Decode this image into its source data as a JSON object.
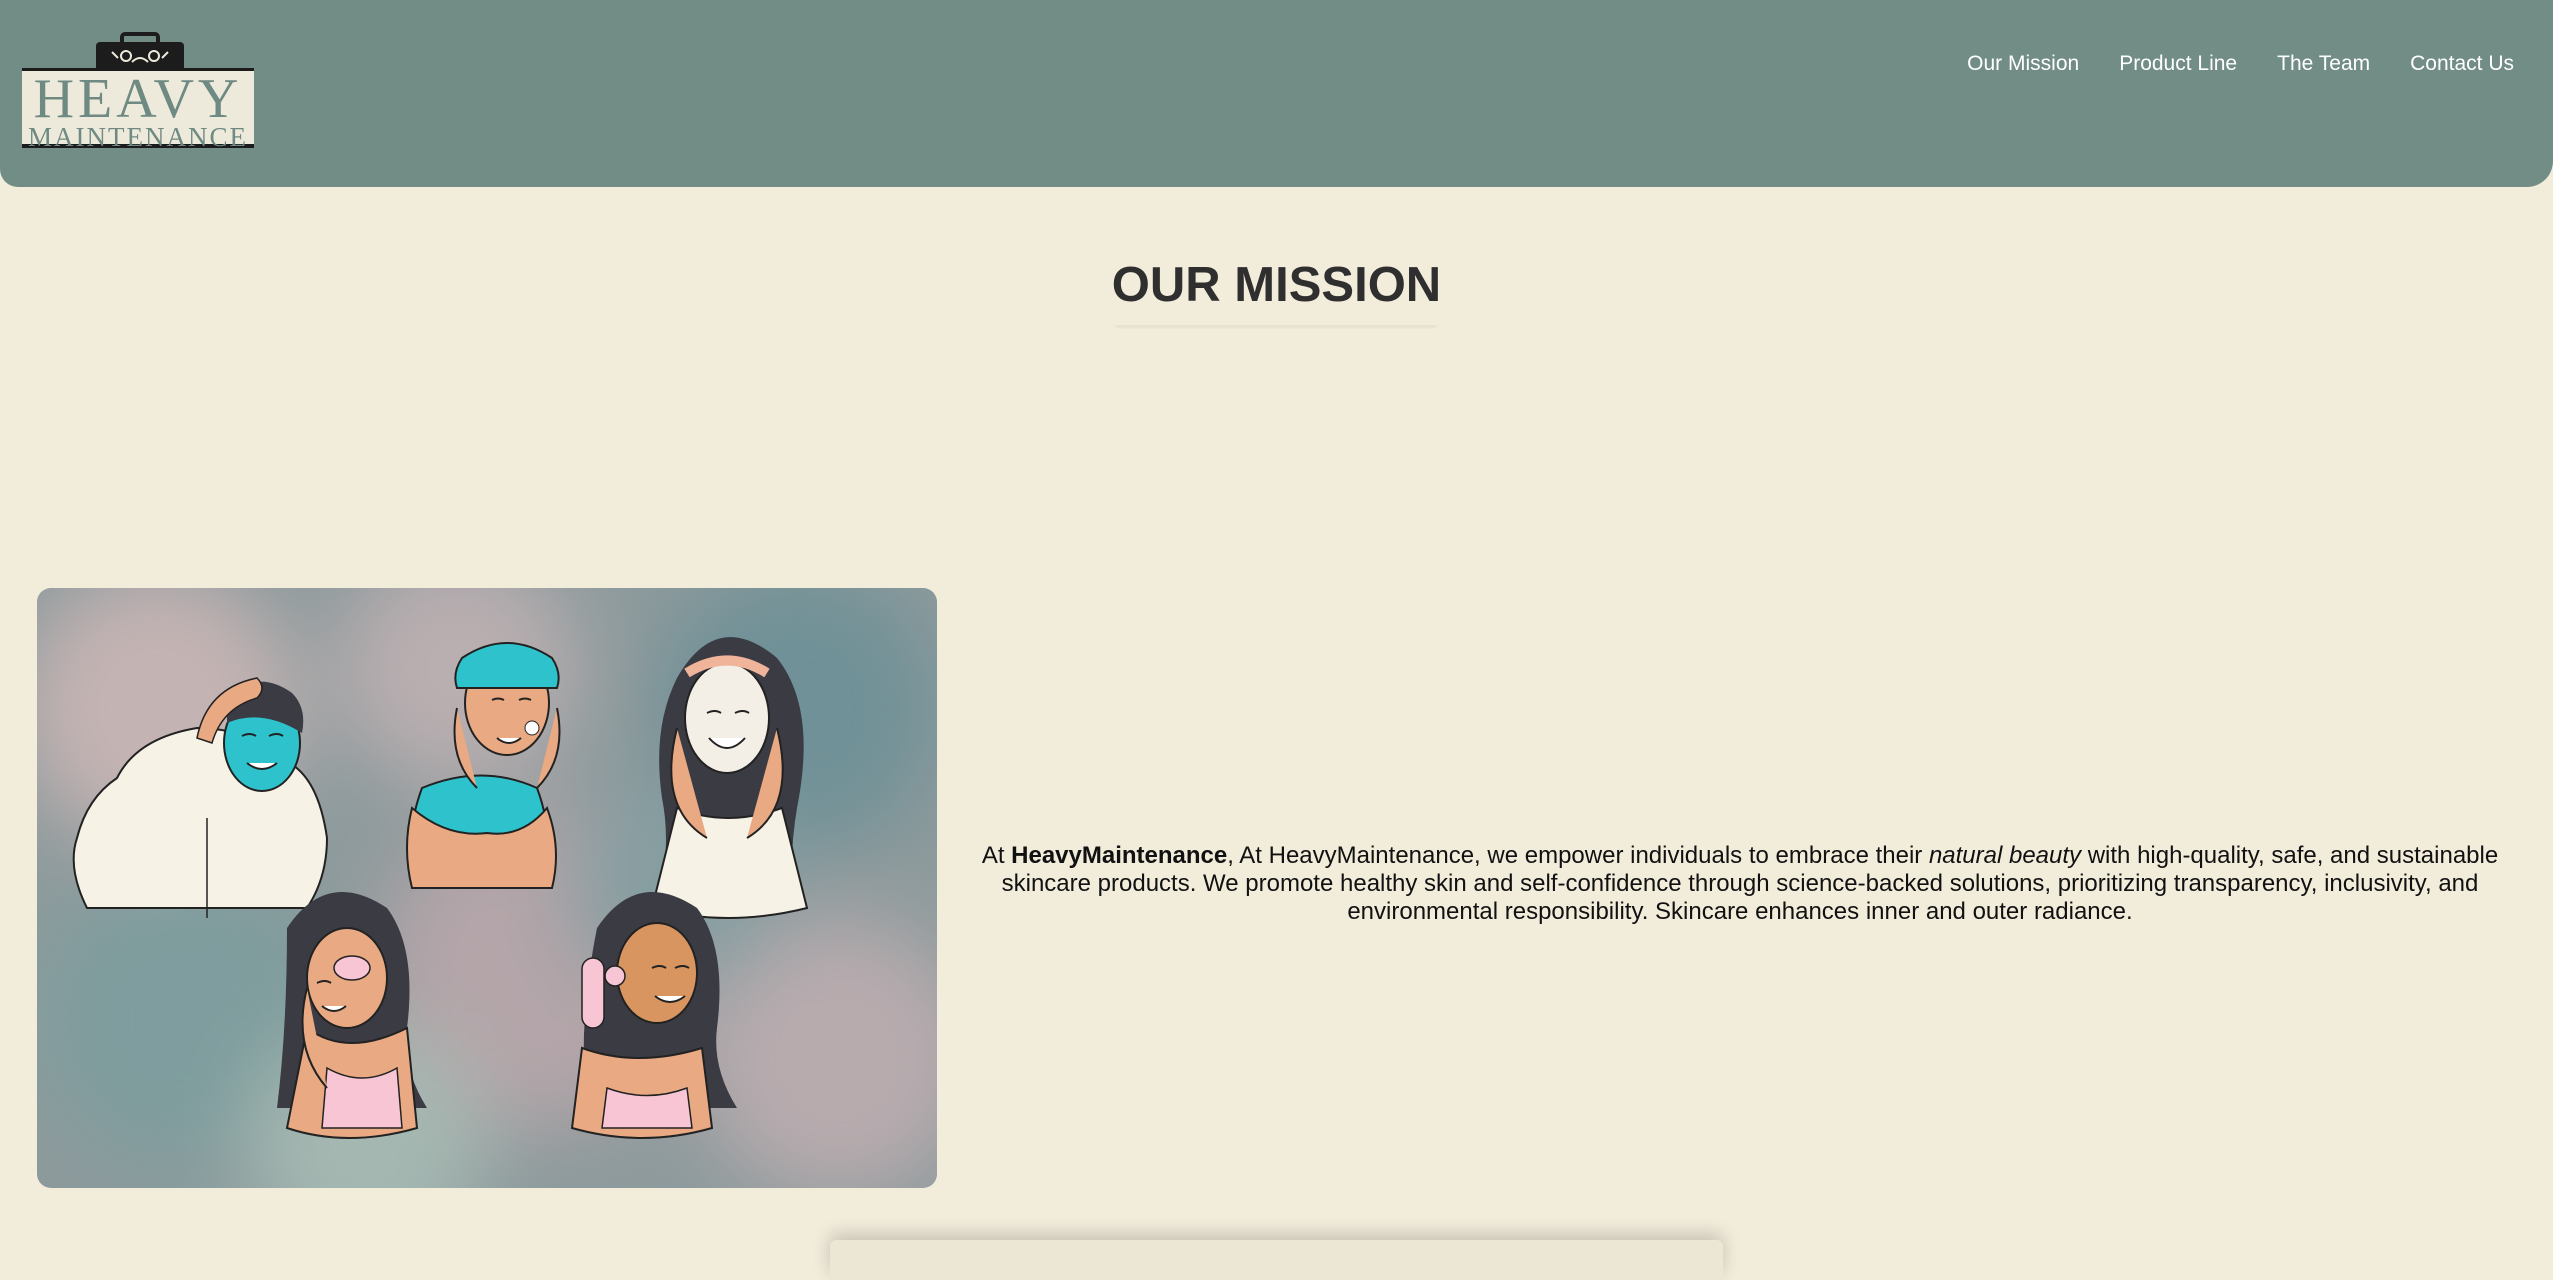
{
  "header": {
    "logo": {
      "line1": "HEAVY",
      "line2": "MAINTENANCE",
      "icon": "briefcase-icon"
    },
    "nav": [
      {
        "label": "Our Mission"
      },
      {
        "label": "Product Line"
      },
      {
        "label": "The Team"
      },
      {
        "label": "Contact Us"
      }
    ]
  },
  "main": {
    "title": "OUR MISSION",
    "image": {
      "icon": "skincare-illustration"
    },
    "mission": {
      "prefix": "At ",
      "brand": "HeavyMaintenance",
      "middle": ", At HeavyMaintenance, we empower individuals to embrace their ",
      "emphasis": "natural beauty",
      "suffix": " with high-quality, safe, and sustainable skincare products. We promote healthy skin and self-confidence through science-backed solutions, prioritizing transparency, inclusivity, and environmental responsibility. Skincare enhances inner and outer radiance."
    }
  },
  "colors": {
    "header_bg": "#718d85",
    "page_bg": "#f2ecdb",
    "title": "#2f2f2f",
    "mask_teal": "#2ec3cc",
    "skin": "#e9a982",
    "pink": "#f7c5d4"
  }
}
